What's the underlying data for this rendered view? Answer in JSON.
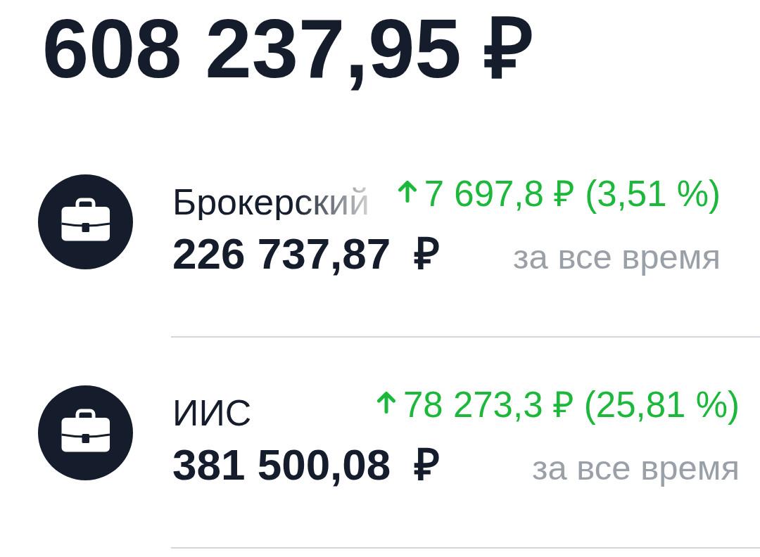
{
  "total": "608 237,95 ₽",
  "accounts": [
    {
      "name": "Брокерский",
      "amount": "226 737,87",
      "currency": "₽",
      "gain": true,
      "change": "7 697,8 ₽ (3,51 %)",
      "period": "за все время"
    },
    {
      "name": "ИИС",
      "amount": "381 500,08",
      "currency": "₽",
      "gain": true,
      "change": "78 273,3 ₽ (25,81 %)",
      "period": "за все время"
    }
  ]
}
